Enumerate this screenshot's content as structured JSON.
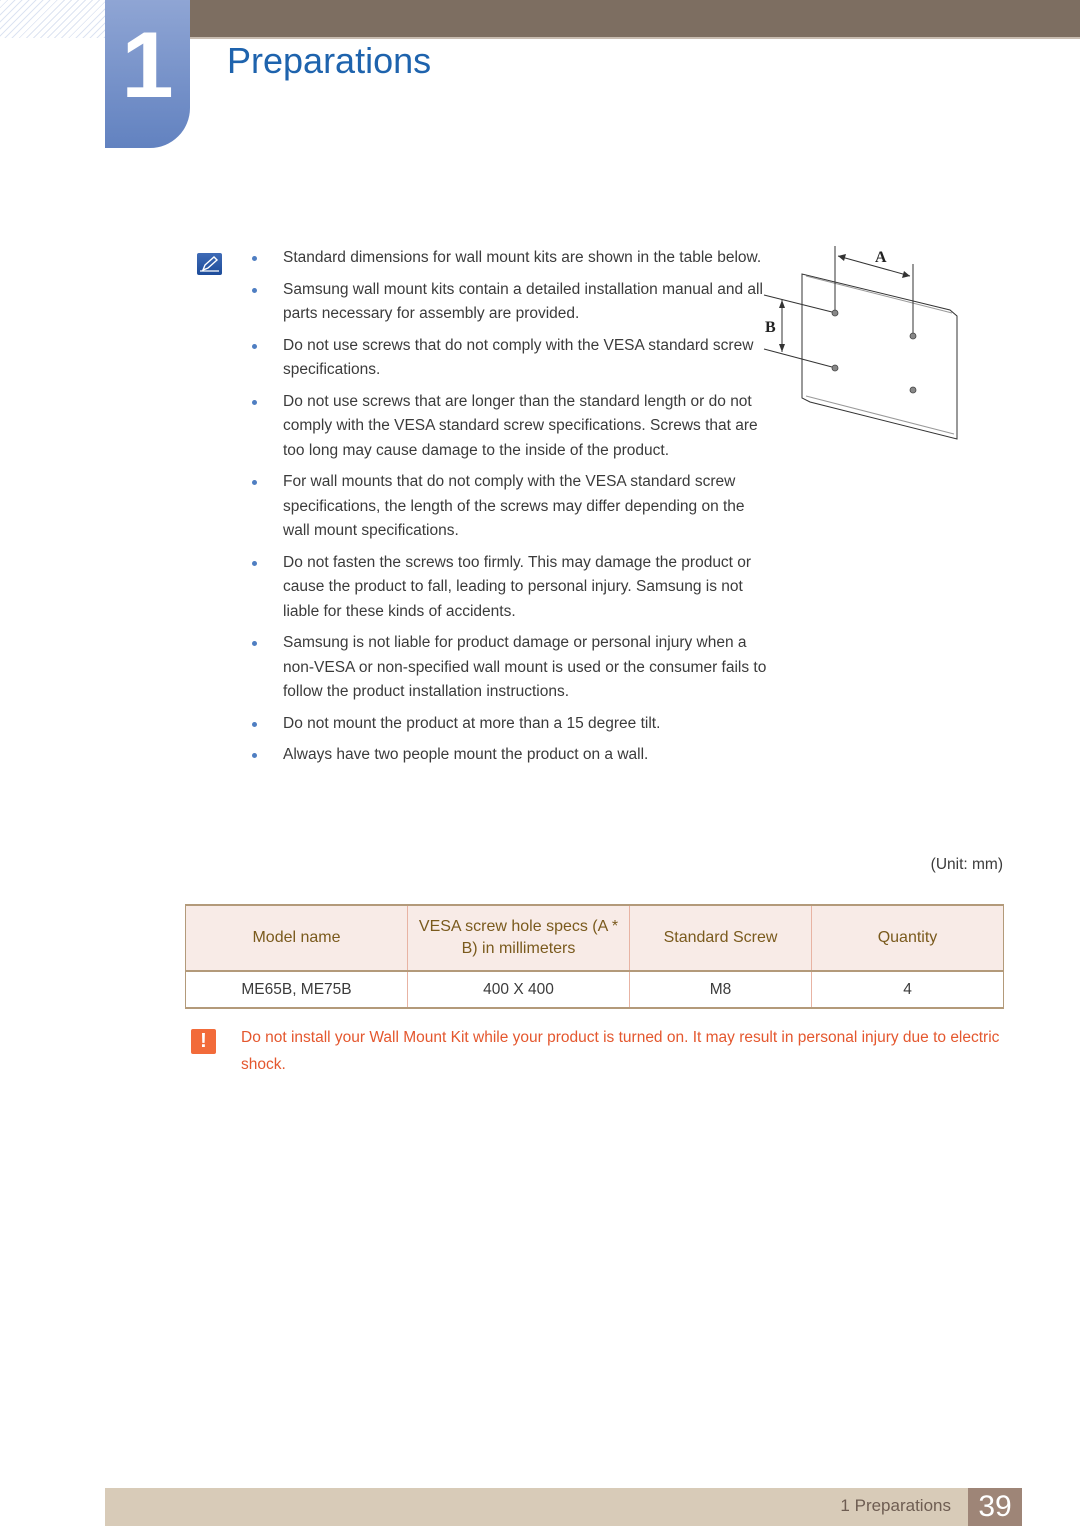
{
  "header": {
    "chapter_number": "1",
    "chapter_title": "Preparations"
  },
  "notes": {
    "icon": "note-pencil-icon",
    "items": [
      "Standard dimensions for wall mount kits are shown in the table below.",
      "Samsung wall mount kits contain a detailed installation manual and all parts necessary for assembly are provided.",
      "Do not use screws that do not comply with the VESA standard screw specifications.",
      "Do not use screws that are longer than the standard length or do not comply with the VESA standard screw specifications. Screws that are too long may cause damage to the inside of the product.",
      "For wall mounts that do not comply with the VESA standard screw specifications, the length of the screws may differ depending on the wall mount specifications.",
      "Do not fasten the screws too firmly. This may damage the product or cause the product to fall, leading to personal injury. Samsung is not liable for these kinds of accidents.",
      "Samsung is not liable for product damage or personal injury when a non-VESA or non-specified wall mount is used or the consumer fails to follow the product installation instructions.",
      "Do not mount the product at more than a 15 degree tilt.",
      "Always have two people mount the product on a wall."
    ]
  },
  "diagram": {
    "label_a": "A",
    "label_b": "B"
  },
  "table": {
    "unit": "(Unit: mm)",
    "headers": [
      "Model name",
      "VESA screw hole specs (A * B) in millimeters",
      "Standard Screw",
      "Quantity"
    ],
    "rows": [
      [
        "ME65B, ME75B",
        "400 X 400",
        "M8",
        "4"
      ]
    ]
  },
  "warning": {
    "icon": "warning-exclamation-icon",
    "symbol": "!",
    "text": "Do not install your Wall Mount Kit while your product is turned on. It may result in personal injury due to electric shock."
  },
  "footer": {
    "section_label": "1 Preparations",
    "page_number": "39"
  },
  "colors": {
    "title_blue": "#1e63ad",
    "header_bar": "#7d6e61",
    "chapter_tab": "#6282c0",
    "warning": "#e4572e",
    "table_header_bg": "#f8ebe7",
    "table_header_text": "#7a5a1d",
    "footer_bg": "#d8cbb8",
    "page_num_bg": "#9e8577"
  }
}
